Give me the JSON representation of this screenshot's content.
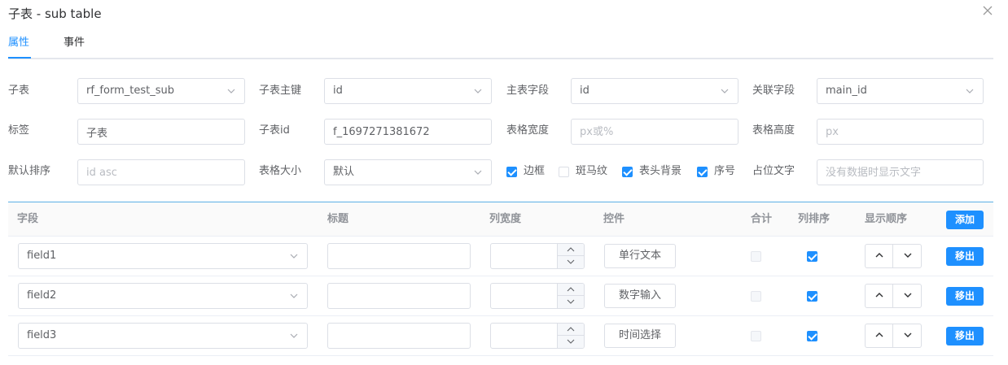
{
  "dialog": {
    "title": "子表 - sub table"
  },
  "tabs": [
    {
      "label": "属性"
    },
    {
      "label": "事件"
    }
  ],
  "form": {
    "sub_table_label": "子表",
    "sub_table_value": "rf_form_test_sub",
    "sub_pk_label": "子表主键",
    "sub_pk_value": "id",
    "main_field_label": "主表字段",
    "main_field_value": "id",
    "link_field_label": "关联字段",
    "link_field_value": "main_id",
    "tag_label": "标签",
    "tag_value": "子表",
    "sub_id_label": "子表id",
    "sub_id_value": "f_1697271381672",
    "width_label": "表格宽度",
    "width_placeholder": "px或%",
    "height_label": "表格高度",
    "height_placeholder": "px",
    "sort_label": "默认排序",
    "sort_placeholder": "id asc",
    "size_label": "表格大小",
    "size_value": "默认",
    "border_label": "边框",
    "border_checked": true,
    "stripe_label": "斑马纹",
    "stripe_checked": false,
    "header_bg_label": "表头背景",
    "header_bg_checked": true,
    "index_label": "序号",
    "index_checked": true,
    "placeholder_label": "占位文字",
    "placeholder_placeholder": "没有数据时显示文字"
  },
  "table": {
    "headers": {
      "field": "字段",
      "title": "标题",
      "width": "列宽度",
      "control": "控件",
      "sum": "合计",
      "sortable": "列排序",
      "order": "显示顺序"
    },
    "add_label": "添加",
    "remove_label": "移出",
    "rows": [
      {
        "field": "field1",
        "title": "",
        "width": "",
        "control": "单行文本",
        "sum": false,
        "sortable": true
      },
      {
        "field": "field2",
        "title": "",
        "width": "",
        "control": "数字输入",
        "sum": false,
        "sortable": true
      },
      {
        "field": "field3",
        "title": "",
        "width": "",
        "control": "时间选择",
        "sum": false,
        "sortable": true
      }
    ]
  },
  "colors": {
    "accent": "#1e90ff",
    "border": "#dcdfe6",
    "text": "#606266"
  }
}
